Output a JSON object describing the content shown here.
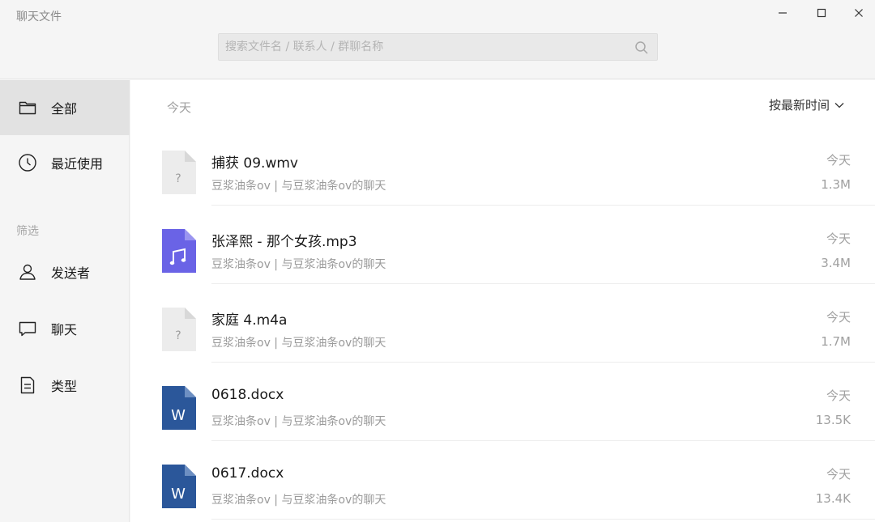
{
  "app": {
    "title": "聊天文件"
  },
  "search": {
    "placeholder": "搜索文件名 / 联系人 / 群聊名称"
  },
  "window_controls": {
    "minimize": "–",
    "maximize": "☐",
    "close": "×"
  },
  "sidebar": {
    "items": [
      {
        "label": "全部",
        "icon": "folder-icon",
        "active": true
      },
      {
        "label": "最近使用",
        "icon": "clock-icon",
        "active": false
      }
    ],
    "filter_heading": "筛选",
    "filters": [
      {
        "label": "发送者",
        "icon": "person-icon"
      },
      {
        "label": "聊天",
        "icon": "chat-bubble-icon"
      },
      {
        "label": "类型",
        "icon": "document-icon"
      }
    ]
  },
  "main": {
    "date_heading": "今天",
    "sort_label": "按最新时间",
    "files": [
      {
        "name": "捕获 09.wmv",
        "source": "豆浆油条ov | 与豆浆油条ov的聊天",
        "date": "今天",
        "size": "1.3M",
        "type": "unknown",
        "icon_glyph": "?"
      },
      {
        "name": "张泽熙 - 那个女孩.mp3",
        "source": "豆浆油条ov | 与豆浆油条ov的聊天",
        "date": "今天",
        "size": "3.4M",
        "type": "music",
        "icon_glyph": "♫"
      },
      {
        "name": "家庭 4.m4a",
        "source": "豆浆油条ov | 与豆浆油条ov的聊天",
        "date": "今天",
        "size": "1.7M",
        "type": "unknown",
        "icon_glyph": "?"
      },
      {
        "name": "0618.docx",
        "source": "豆浆油条ov | 与豆浆油条ov的聊天",
        "date": "今天",
        "size": "13.5K",
        "type": "word",
        "icon_glyph": "W"
      },
      {
        "name": "0617.docx",
        "source": "豆浆油条ov | 与豆浆油条ov的聊天",
        "date": "今天",
        "size": "13.4K",
        "type": "word",
        "icon_glyph": "W"
      }
    ]
  },
  "colors": {
    "music": "#6a63e6",
    "word": "#2b579a",
    "unknown": "#ececec",
    "unknown_fold": "#d8d8d8"
  }
}
